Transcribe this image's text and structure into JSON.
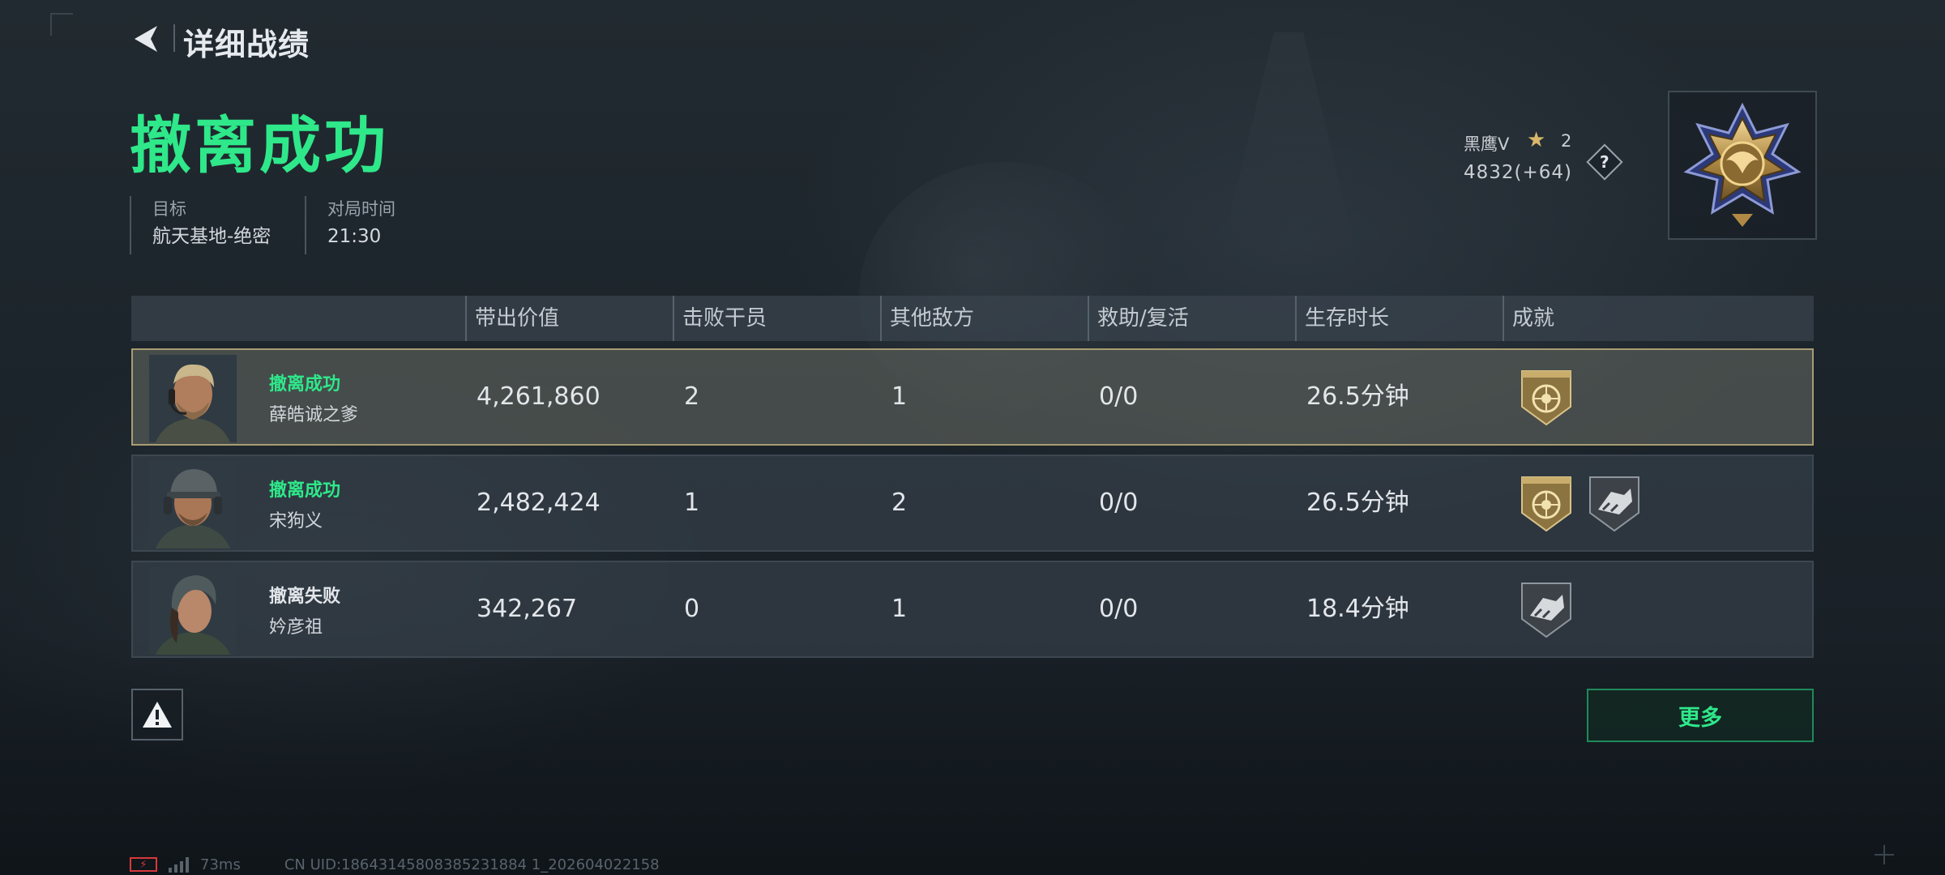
{
  "header": {
    "back_icon": "back-arrow-icon",
    "title": "详细战绩"
  },
  "result": {
    "title": "撤离成功",
    "title_color": "#2ee88a",
    "target_label": "目标",
    "target_value": "航天基地-绝密",
    "time_label": "对局时间",
    "time_value": "21:30"
  },
  "rank": {
    "name": "黑鹰V",
    "star_icon": "star-icon",
    "level": "2",
    "score": "4832(+64)",
    "help_label": "?",
    "medal_icon": "rank-medal-icon"
  },
  "table": {
    "headers": [
      "带出价值",
      "击败干员",
      "其他敌方",
      "救助/复活",
      "生存时长",
      "成就"
    ],
    "rows": [
      {
        "status": "撤离成功",
        "status_type": "success",
        "name": "薛皓诚之爹",
        "value": "4,261,860",
        "kills": "2",
        "other_enemies": "1",
        "assist_revive": "0/0",
        "survival": "26.5分钟",
        "achievements": [
          "gold-shield-badge-icon"
        ],
        "highlighted": true
      },
      {
        "status": "撤离成功",
        "status_type": "success",
        "name": "宋狗义",
        "value": "2,482,424",
        "kills": "1",
        "other_enemies": "2",
        "assist_revive": "0/0",
        "survival": "26.5分钟",
        "achievements": [
          "gold-shield-badge-icon",
          "grey-cargo-badge-icon"
        ],
        "highlighted": false
      },
      {
        "status": "撤离失败",
        "status_type": "fail",
        "name": "妗彦祖",
        "value": "342,267",
        "kills": "0",
        "other_enemies": "1",
        "assist_revive": "0/0",
        "survival": "18.4分钟",
        "achievements": [
          "grey-cargo-badge-icon"
        ],
        "highlighted": false
      }
    ]
  },
  "footer": {
    "report_icon": "warning-icon",
    "more_label": "更多",
    "latency": "73ms",
    "uid": "CN UID:18643145808385231884 1_202604022158"
  }
}
